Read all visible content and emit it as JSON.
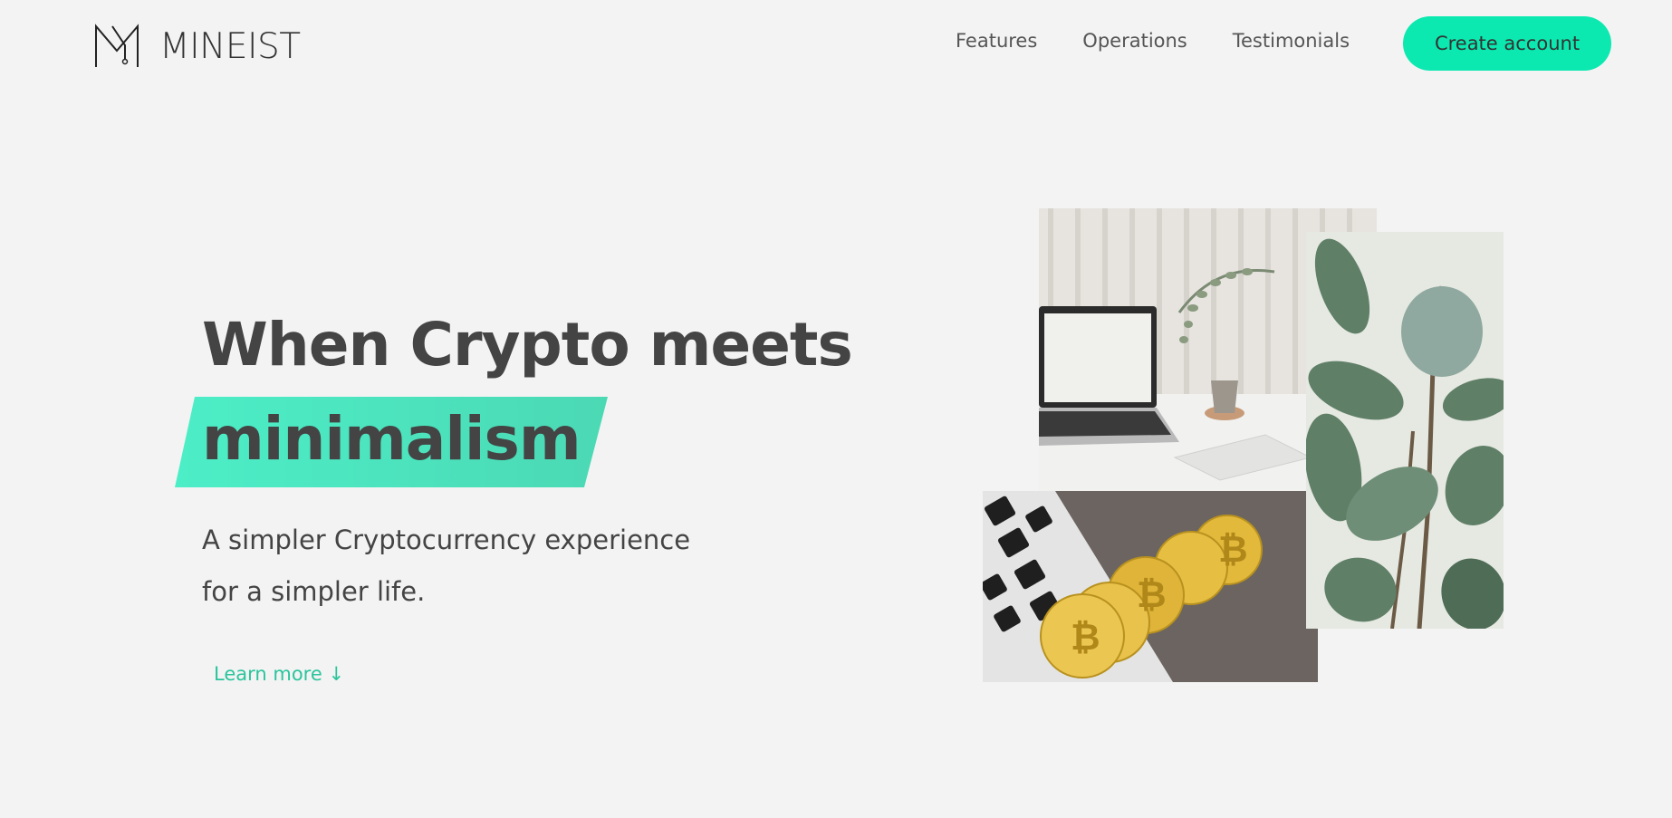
{
  "brand": {
    "name": "MINEIST",
    "logo_icon": "m-logo-icon"
  },
  "nav": {
    "links": [
      "Features",
      "Operations",
      "Testimonials"
    ],
    "cta_label": "Create account"
  },
  "hero": {
    "title_line1": "When Crypto meets",
    "title_highlight": "minimalism",
    "subtitle_line1": "A simpler Cryptocurrency experience",
    "subtitle_line2": "for a simpler life.",
    "learn_more_label": "Learn more ↓"
  },
  "images": {
    "laptop": "laptop-desk-photo",
    "plant": "plant-leaves-photo",
    "coins": "bitcoin-coins-photo"
  },
  "colors": {
    "accent": "#0ce9b0",
    "highlight": "#4ceec7",
    "link": "#2bc49c",
    "background": "#f3f3f3",
    "text": "#444444"
  }
}
